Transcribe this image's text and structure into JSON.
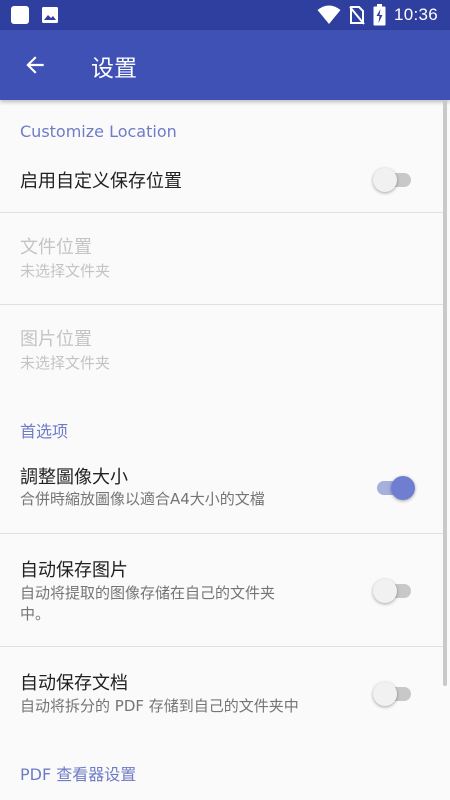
{
  "status_bar": {
    "time": "10:36",
    "icons": [
      "square-icon",
      "image-icon",
      "wifi-icon",
      "no-sim-icon",
      "battery-charging-icon"
    ]
  },
  "app_bar": {
    "title": "设置",
    "back_icon": "arrow-back-icon"
  },
  "sections": {
    "custom_location": {
      "header": "Customize Location",
      "enable": {
        "title": "启用自定义保存位置",
        "enabled": false
      },
      "file_location": {
        "title": "文件位置",
        "summary": "未选择文件夹"
      },
      "image_location": {
        "title": "图片位置",
        "summary": "未选择文件夹"
      }
    },
    "preferences": {
      "header": "首选项",
      "resize": {
        "title": "調整圖像大小",
        "summary": "合併時縮放圖像以適合A4大小的文檔",
        "enabled": true
      },
      "auto_save_images": {
        "title": "自动保存图片",
        "summary_line1": "自动将提取的图像存储在自己的文件夹",
        "summary_line2": "中。",
        "enabled": false
      },
      "auto_save_docs": {
        "title": "自动保存文档",
        "summary": "自动将拆分的 PDF 存储到自己的文件夹中",
        "enabled": false
      }
    },
    "pdf_viewer": {
      "header": "PDF 查看器设置"
    }
  },
  "colors": {
    "primary": "#3f51b5",
    "primary_dark": "#2f3f9f",
    "accent": "#6f7ed1",
    "section_header": "#6f7bc7"
  }
}
